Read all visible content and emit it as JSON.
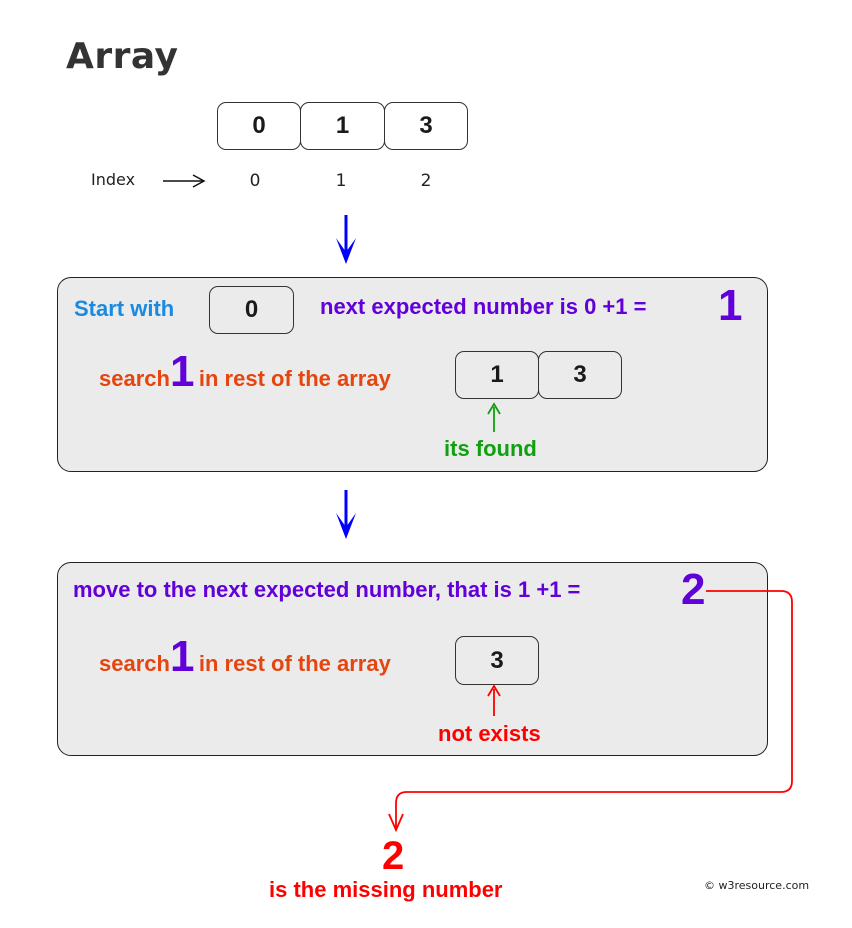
{
  "title": "Array",
  "array": {
    "values": [
      "0",
      "1",
      "3"
    ],
    "index_label": "Index",
    "indices": [
      "0",
      "1",
      "2"
    ]
  },
  "step1": {
    "start_label": "Start with",
    "start_value": "0",
    "expected_text": "next expected number is 0 +1 =",
    "expected_value": "1",
    "search_word": "search",
    "search_value": "1",
    "search_rest": "in rest of the array",
    "rest_values": [
      "1",
      "3"
    ],
    "result": "its found"
  },
  "step2": {
    "expected_text": "move to the next expected number, that is 1 +1 =",
    "expected_value": "2",
    "search_word": "search",
    "search_value": "1",
    "search_rest": "in rest of the array",
    "rest_values": [
      "3"
    ],
    "result": "not exists"
  },
  "answer": {
    "value": "2",
    "text": "is the missing number"
  },
  "copyright": "© w3resource.com",
  "colors": {
    "purple": "#6200d9",
    "orange": "#e5450e",
    "blue": "#1a8ae0",
    "green": "#10a010",
    "red": "#ff0000",
    "arrow_blue": "#0000ff",
    "box_gray": "#ebebeb"
  }
}
